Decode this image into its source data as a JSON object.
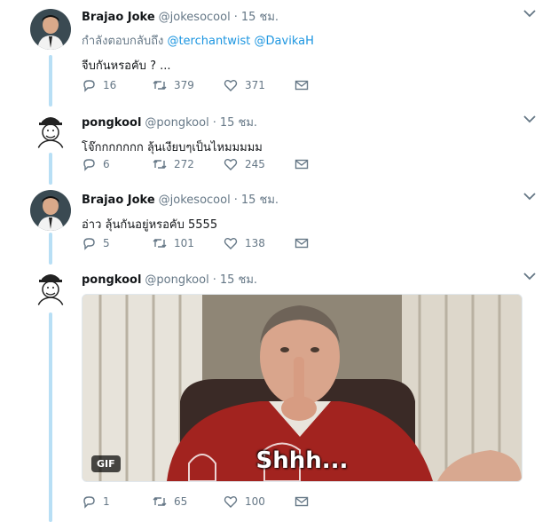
{
  "tweets": [
    {
      "name": "Brajao Joke",
      "handle": "@jokesocool",
      "dot": "·",
      "time": "15 ชม.",
      "reply_prefix": "กำลังตอบกลับถึง",
      "reply_mentions": [
        "@terchantwist",
        "@DavikaH"
      ],
      "text": "จีบกันหรอคับ ? ...",
      "replies": "16",
      "retweets": "379",
      "likes": "371"
    },
    {
      "name": "pongkool",
      "handle": "@pongkool",
      "dot": "·",
      "time": "15 ชม.",
      "text": "โจ๊กกกกกกก ลุ้นเงียบๆเป็นไหมมมมม",
      "replies": "6",
      "retweets": "272",
      "likes": "245"
    },
    {
      "name": "Brajao Joke",
      "handle": "@jokesocool",
      "dot": "·",
      "time": "15 ชม.",
      "text": "อ่าว ลุ้นกันอยู่หรอคับ 5555",
      "replies": "5",
      "retweets": "101",
      "likes": "138"
    },
    {
      "name": "pongkool",
      "handle": "@pongkool",
      "dot": "·",
      "time": "15 ชม.",
      "media": {
        "badge": "GIF",
        "subtitle": "Shhh..."
      },
      "replies": "1",
      "retweets": "65",
      "likes": "100"
    }
  ],
  "colors": {
    "thread_line": "#b8dff5",
    "link": "#1b95e0",
    "muted": "#657786"
  },
  "icons": [
    "reply-icon",
    "retweet-icon",
    "like-icon",
    "dm-icon",
    "chevron-down-icon"
  ]
}
